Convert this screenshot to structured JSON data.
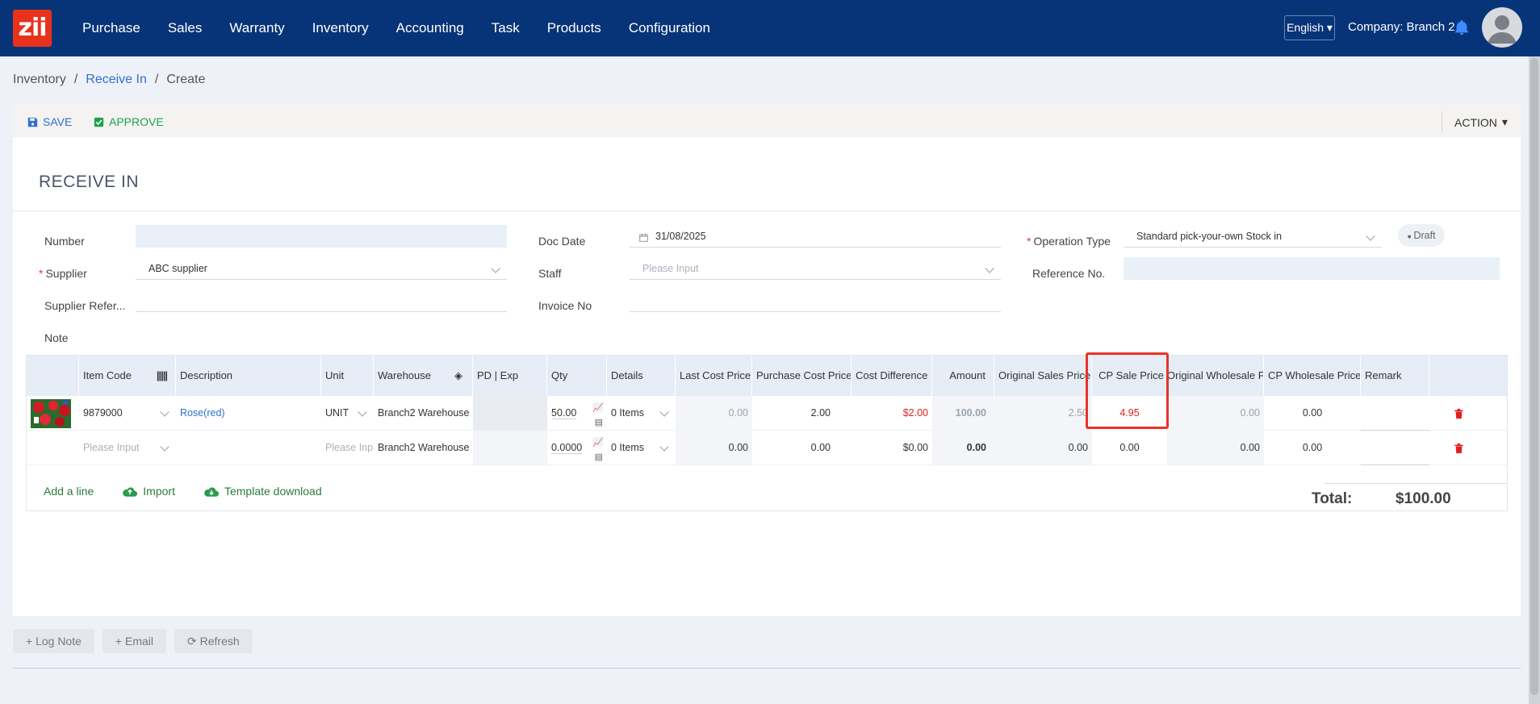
{
  "app": {
    "logo_text": "zii"
  },
  "nav": {
    "items": [
      "Purchase",
      "Sales",
      "Warranty",
      "Inventory",
      "Accounting",
      "Task",
      "Products",
      "Configuration"
    ],
    "language": "English",
    "company": "Company: Branch 2"
  },
  "breadcrumb": {
    "root": "Inventory",
    "middle": "Receive In",
    "current": "Create",
    "sep": "/"
  },
  "toolbar": {
    "save": "SAVE",
    "approve": "APPROVE",
    "action": "ACTION"
  },
  "form": {
    "title": "RECEIVE IN",
    "status": "Draft",
    "number_label": "Number",
    "number_value": "",
    "supplier_label": "Supplier",
    "supplier_value": "ABC supplier",
    "supplier_ref_label": "Supplier Refer...",
    "supplier_ref_value": "",
    "note_label": "Note",
    "note_value": "",
    "doc_date_label": "Doc Date",
    "doc_date_value": "31/08/2025",
    "staff_label": "Staff",
    "staff_placeholder": "Please Input",
    "invoice_label": "Invoice No",
    "invoice_value": "",
    "op_type_label": "Operation Type",
    "op_type_value": "Standard pick-your-own Stock in",
    "ref_no_label": "Reference No.",
    "ref_no_value": ""
  },
  "table": {
    "headers": [
      "",
      "Item Code",
      "Description",
      "Unit",
      "Warehouse",
      "PD | Exp",
      "Qty",
      "Details",
      "Last Cost Price",
      "Purchase Cost Price",
      "Cost Difference",
      "Amount",
      "Original Sales Price",
      "CP Sale Price",
      "Original Wholesale Price",
      "CP Wholesale Price",
      "Remark",
      ""
    ],
    "rows": [
      {
        "item_code": "9879000",
        "description": "Rose(red)",
        "unit": "UNIT",
        "warehouse": "Branch2 Warehouse",
        "pd_exp": "",
        "qty": "50.00",
        "details": "0 Items",
        "last_cost": "0.00",
        "purchase_cost": "2.00",
        "cost_diff": "$2.00",
        "amount": "100.00",
        "orig_sales": "2.50",
        "cp_sale": "4.95",
        "orig_wholesale": "0.00",
        "cp_wholesale": "0.00",
        "remark": ""
      },
      {
        "item_code": "Please Input",
        "description": "",
        "unit": "Please Input",
        "warehouse": "Branch2 Warehouse",
        "pd_exp": "",
        "qty": "0.0000",
        "details": "0 Items",
        "last_cost": "0.00",
        "purchase_cost": "0.00",
        "cost_diff": "$0.00",
        "amount": "0.00",
        "orig_sales": "0.00",
        "cp_sale": "0.00",
        "orig_wholesale": "0.00",
        "cp_wholesale": "0.00",
        "remark": ""
      }
    ],
    "add_line": "Add a line",
    "import": "Import",
    "template": "Template download",
    "total_label": "Total:",
    "total_value": "$100.00"
  },
  "bottom": {
    "log_note": "Log Note",
    "email": "Email",
    "refresh": "Refresh"
  },
  "colors": {
    "nav": "#073478",
    "accent": "#2f6fd0",
    "danger": "#e02020",
    "success": "#2a7a3c"
  }
}
